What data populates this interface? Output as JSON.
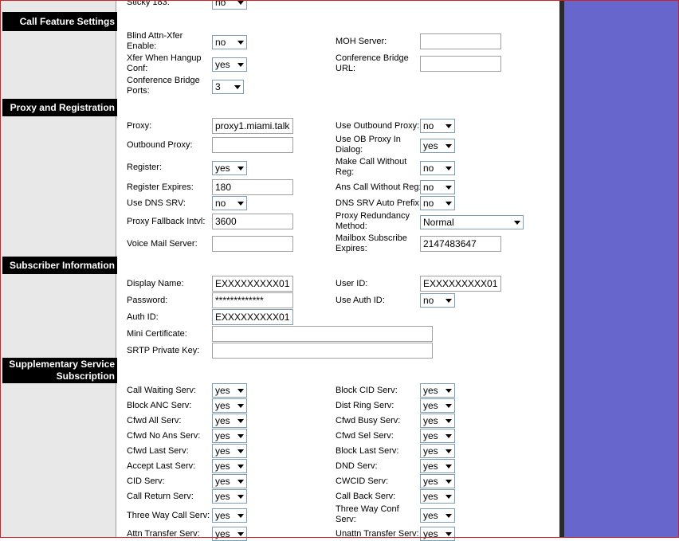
{
  "top": {
    "sticky_label": "Sticky 183:",
    "sticky_value": "no"
  },
  "sections": {
    "call_feature": "Call Feature Settings",
    "proxy": "Proxy and Registration",
    "subscriber": "Subscriber Information",
    "supp_line1": "Supplementary Service",
    "supp_line2": "Subscription"
  },
  "call_feature": {
    "blind_attn_label_1": "Blind Attn-Xfer",
    "blind_attn_label_2": "Enable:",
    "blind_attn_value": "no",
    "xfer_hangup_label_1": "Xfer When Hangup",
    "xfer_hangup_label_2": "Conf:",
    "xfer_hangup_value": "yes",
    "conf_ports_label_1": "Conference Bridge",
    "conf_ports_label_2": "Ports:",
    "conf_ports_value": "3",
    "moh_server_label": "MOH Server:",
    "moh_server_value": "",
    "conf_url_label_1": "Conference Bridge",
    "conf_url_label_2": "URL:",
    "conf_url_value": ""
  },
  "proxy": {
    "proxy_label": "Proxy:",
    "proxy_value": "proxy1.miami.talk",
    "outbound_proxy_label": "Outbound Proxy:",
    "outbound_proxy_value": "",
    "register_label": "Register:",
    "register_value": "yes",
    "register_expires_label": "Register Expires:",
    "register_expires_value": "180",
    "use_dns_srv_label": "Use DNS SRV:",
    "use_dns_srv_value": "no",
    "proxy_fallback_label": "Proxy Fallback Intvl:",
    "proxy_fallback_value": "3600",
    "voice_mail_label": "Voice Mail Server:",
    "voice_mail_value": "",
    "use_outbound_label": "Use Outbound Proxy:",
    "use_outbound_value": "no",
    "use_ob_dialog_label_1": "Use OB Proxy In",
    "use_ob_dialog_label_2": "Dialog:",
    "use_ob_dialog_value": "yes",
    "make_call_label_1": "Make Call Without",
    "make_call_label_2": "Reg:",
    "make_call_value": "no",
    "ans_call_label": "Ans Call Without Reg:",
    "ans_call_value": "no",
    "dns_srv_prefix_label": "DNS SRV Auto Prefix:",
    "dns_srv_prefix_value": "no",
    "redundancy_label_1": "Proxy Redundancy",
    "redundancy_label_2": "Method:",
    "redundancy_value": "Normal",
    "mailbox_label_1": "Mailbox Subscribe",
    "mailbox_label_2": "Expires:",
    "mailbox_value": "2147483647"
  },
  "subscriber": {
    "display_name_label": "Display Name:",
    "display_name_value": "EXXXXXXXXX01",
    "password_label": "Password:",
    "password_value": "*************",
    "auth_id_label": "Auth ID:",
    "auth_id_value": "EXXXXXXXXX01",
    "mini_cert_label": "Mini Certificate:",
    "mini_cert_value": "",
    "srtp_label": "SRTP Private Key:",
    "srtp_value": "",
    "user_id_label": "User ID:",
    "user_id_value": "EXXXXXXXXX01",
    "use_auth_id_label": "Use Auth ID:",
    "use_auth_id_value": "no"
  },
  "supplementary": {
    "left": [
      {
        "label": "Call Waiting Serv:",
        "value": "yes"
      },
      {
        "label": "Block ANC Serv:",
        "value": "yes"
      },
      {
        "label": "Cfwd All Serv:",
        "value": "yes"
      },
      {
        "label": "Cfwd No Ans Serv:",
        "value": "yes"
      },
      {
        "label": "Cfwd Last Serv:",
        "value": "yes"
      },
      {
        "label": "Accept Last Serv:",
        "value": "yes"
      },
      {
        "label": "CID Serv:",
        "value": "yes"
      },
      {
        "label": "Call Return Serv:",
        "value": "yes"
      },
      {
        "label": "Three Way Call Serv:",
        "value": "yes"
      },
      {
        "label": "Attn Transfer Serv:",
        "value": "yes"
      }
    ],
    "right": [
      {
        "label": "Block CID Serv:",
        "value": "yes"
      },
      {
        "label": "Dist Ring Serv:",
        "value": "yes"
      },
      {
        "label": "Cfwd Busy Serv:",
        "value": "yes"
      },
      {
        "label": "Cfwd Sel Serv:",
        "value": "yes"
      },
      {
        "label": "Block Last Serv:",
        "value": "yes"
      },
      {
        "label": "DND Serv:",
        "value": "yes"
      },
      {
        "label": "CWCID Serv:",
        "value": "yes"
      },
      {
        "label": "Call Back Serv:",
        "value": "yes"
      },
      {
        "label": "Three Way Conf Serv:",
        "value": "yes"
      },
      {
        "label": "Unattn Transfer Serv:",
        "value": "yes"
      }
    ]
  },
  "colors": {
    "accent_right": "#6666cc",
    "section_bg": "#000000",
    "frame": "#d42020"
  }
}
